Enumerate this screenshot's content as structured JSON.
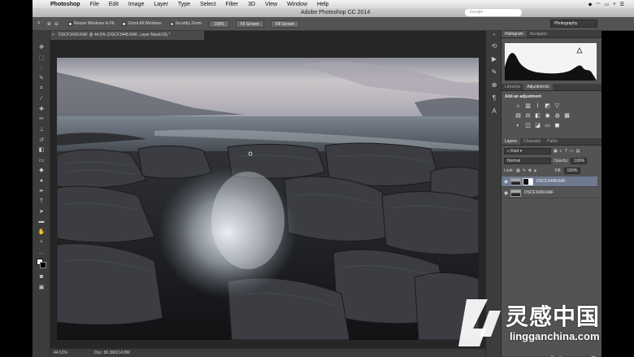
{
  "menubar": {
    "items": [
      "Photoshop",
      "File",
      "Edit",
      "Image",
      "Layer",
      "Type",
      "Select",
      "Filter",
      "3D",
      "View",
      "Window",
      "Help"
    ]
  },
  "window": {
    "title": "Adobe Photoshop CC 2014",
    "search_placeholder": "Google"
  },
  "options": {
    "resize_windows": "Resize Windows to Fit",
    "zoom_all": "Zoom All Windows",
    "scrubby_zoom": "Scrubby Zoom",
    "btn_100": "100%",
    "btn_fit": "Fit Screen",
    "btn_fill": "Fill Screen",
    "workspace": "Photography"
  },
  "document": {
    "tab_title": "DSCF3439.RAF @ 44.6% (DSCF3448.RAF, Layer Mask/16) *",
    "zoom": "44.61%",
    "doc_size": "Doc: 86.3M/214.8M"
  },
  "panels": {
    "histogram_tabs": [
      "Histogram",
      "Navigator"
    ],
    "adjust_tabs": [
      "Libraries",
      "Adjustments"
    ],
    "add_adjustment": "Add an adjustment",
    "layers_tabs": [
      "Layers",
      "Channels",
      "Paths"
    ],
    "kind": "Kind",
    "blend_mode": "Normal",
    "opacity_label": "Opacity:",
    "opacity_value": "100%",
    "lock_label": "Lock:",
    "fill_label": "Fill:",
    "fill_value": "100%",
    "layers": [
      {
        "name": "DSCF3448.RAF",
        "active": true
      },
      {
        "name": "DSCF3439.RAF",
        "active": false
      }
    ]
  },
  "watermark": {
    "chinese": "灵感中国",
    "english": "lingganchina.com"
  }
}
